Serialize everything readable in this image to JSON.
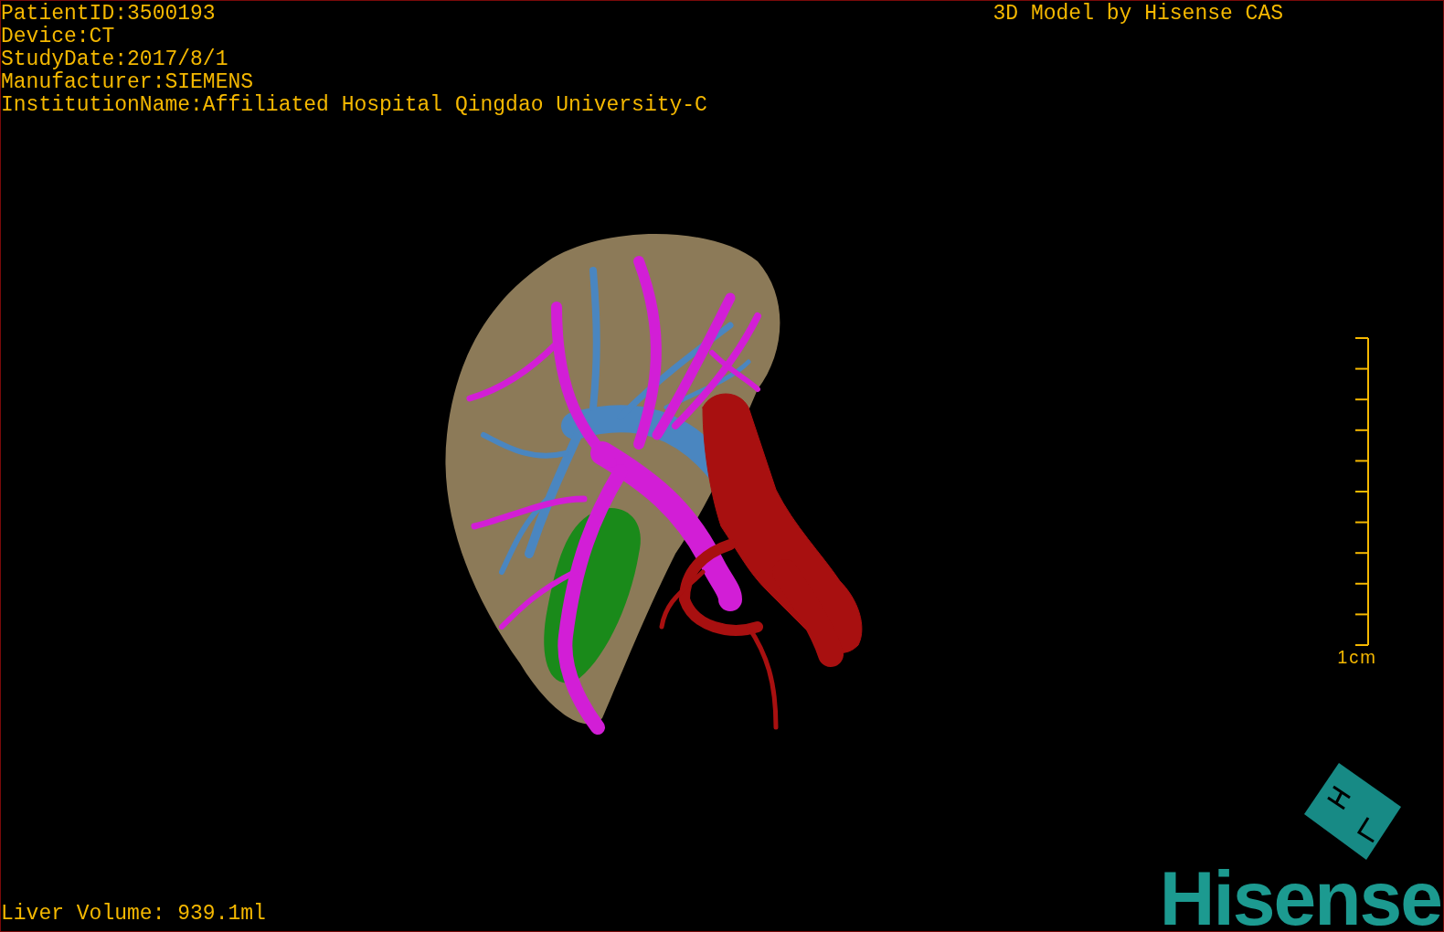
{
  "study_info": [
    "PatientID:3500193",
    "Device:CT",
    "StudyDate:2017/8/1",
    "Manufacturer:SIEMENS",
    "InstitutionName:Affiliated Hospital Qingdao University-C"
  ],
  "title": "3D Model by Hisense CAS",
  "scale_bar": {
    "label": "1cm"
  },
  "liver_volume": "Liver Volume: 939.1ml",
  "logo": {
    "text": "Hisense"
  }
}
